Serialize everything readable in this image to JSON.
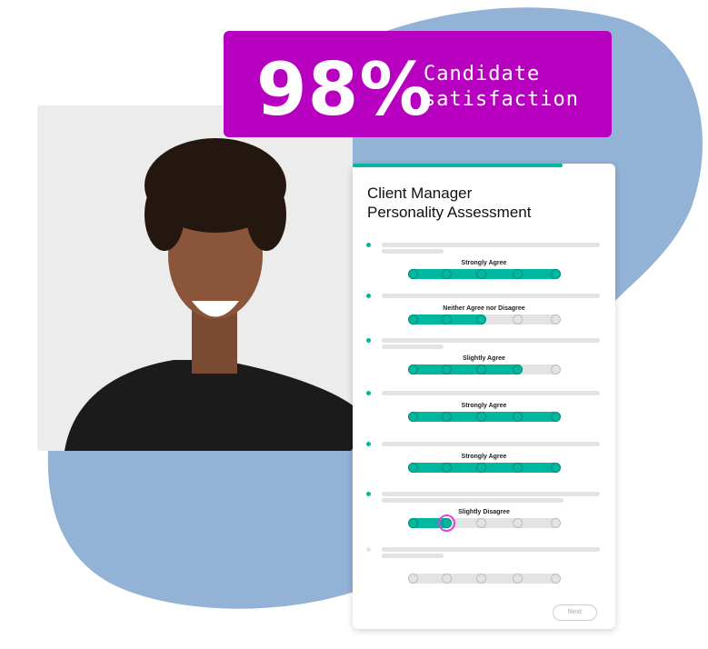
{
  "badge": {
    "value": "98%",
    "caption_line1": "Candidate",
    "caption_line2": "satisfaction"
  },
  "card": {
    "title_line1": "Client Manager",
    "title_line2": "Personality Assessment",
    "progress_percent": 80,
    "next_label": "Next",
    "questions": [
      {
        "answer": "Strongly Agree",
        "level": 5,
        "answered": true,
        "lines": 2
      },
      {
        "answer": "Neither Agree nor Disagree",
        "level": 3,
        "answered": true,
        "lines": 1
      },
      {
        "answer": "Slightly Agree",
        "level": 4,
        "answered": true,
        "lines": 2
      },
      {
        "answer": "Strongly Agree",
        "level": 5,
        "answered": true,
        "lines": 1
      },
      {
        "answer": "Strongly Agree",
        "level": 5,
        "answered": true,
        "lines": 1
      },
      {
        "answer": "Slightly Disagree",
        "level": 2,
        "answered": true,
        "lines": 2,
        "active": true
      },
      {
        "answer": "",
        "level": 0,
        "answered": false,
        "lines": 2
      }
    ]
  },
  "colors": {
    "accent": "#00b8a0",
    "badge": "#b800c0",
    "blob": "#92b2d6"
  }
}
